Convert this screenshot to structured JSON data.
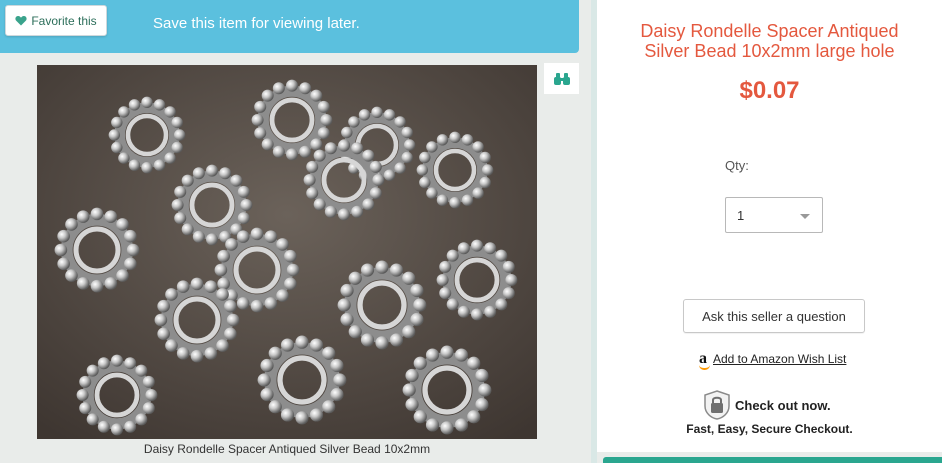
{
  "banner": {
    "favorite_label": "Favorite this",
    "message": "Save this item for viewing later."
  },
  "image": {
    "caption": "Daisy Rondelle Spacer Antiqued Silver Bead 10x2mm"
  },
  "product": {
    "title_line1": "Daisy Rondelle Spacer Antiqued",
    "title_line2": "Silver Bead 10x2mm large hole",
    "price": "$0.07",
    "qty_label": "Qty:",
    "qty_value": "1",
    "ask_label": "Ask this seller a question",
    "amazon_label": "Add to Amazon Wish List",
    "checkout_label": "Check out now.",
    "checkout_sub": "Fast, Easy, Secure Checkout."
  },
  "colors": {
    "banner": "#5bc0de",
    "accent": "#e4583e",
    "panel_bottom": "#2aa68f"
  }
}
